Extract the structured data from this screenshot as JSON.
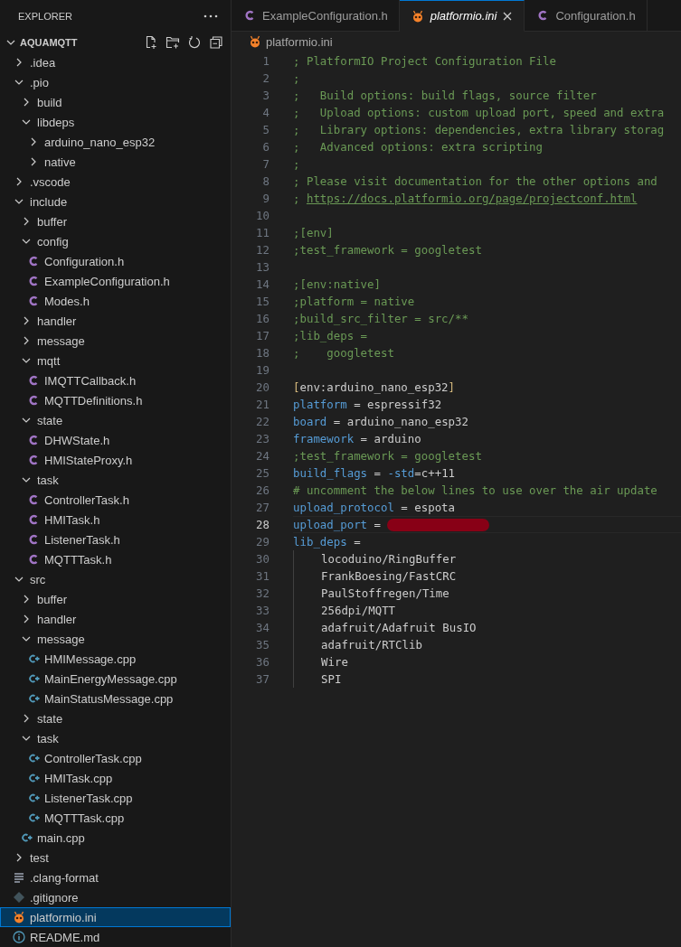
{
  "sidebar": {
    "title": "EXPLORER",
    "project": {
      "name": "AQUAMQTT",
      "expanded": true,
      "children": [
        {
          "name": ".idea",
          "kind": "folder",
          "expanded": false,
          "selected": false
        },
        {
          "name": ".pio",
          "kind": "folder",
          "expanded": true,
          "selected": false,
          "children": [
            {
              "name": "build",
              "kind": "folder",
              "expanded": false,
              "selected": false
            },
            {
              "name": "libdeps",
              "kind": "folder",
              "expanded": true,
              "selected": false,
              "children": [
                {
                  "name": "arduino_nano_esp32",
                  "kind": "folder",
                  "expanded": false,
                  "selected": false
                },
                {
                  "name": "native",
                  "kind": "folder",
                  "expanded": false,
                  "selected": false
                }
              ]
            }
          ]
        },
        {
          "name": ".vscode",
          "kind": "folder",
          "expanded": false,
          "selected": false
        },
        {
          "name": "include",
          "kind": "folder",
          "expanded": true,
          "selected": false,
          "children": [
            {
              "name": "buffer",
              "kind": "folder",
              "expanded": false,
              "selected": false
            },
            {
              "name": "config",
              "kind": "folder",
              "expanded": true,
              "selected": false,
              "children": [
                {
                  "name": "Configuration.h",
                  "kind": "c-header",
                  "selected": false
                },
                {
                  "name": "ExampleConfiguration.h",
                  "kind": "c-header",
                  "selected": false
                },
                {
                  "name": "Modes.h",
                  "kind": "c-header",
                  "selected": false
                }
              ]
            },
            {
              "name": "handler",
              "kind": "folder",
              "expanded": false,
              "selected": false
            },
            {
              "name": "message",
              "kind": "folder",
              "expanded": false,
              "selected": false
            },
            {
              "name": "mqtt",
              "kind": "folder",
              "expanded": true,
              "selected": false,
              "children": [
                {
                  "name": "IMQTTCallback.h",
                  "kind": "c-header",
                  "selected": false
                },
                {
                  "name": "MQTTDefinitions.h",
                  "kind": "c-header",
                  "selected": false
                }
              ]
            },
            {
              "name": "state",
              "kind": "folder",
              "expanded": true,
              "selected": false,
              "children": [
                {
                  "name": "DHWState.h",
                  "kind": "c-header",
                  "selected": false
                },
                {
                  "name": "HMIStateProxy.h",
                  "kind": "c-header",
                  "selected": false
                }
              ]
            },
            {
              "name": "task",
              "kind": "folder",
              "expanded": true,
              "selected": false,
              "children": [
                {
                  "name": "ControllerTask.h",
                  "kind": "c-header",
                  "selected": false
                },
                {
                  "name": "HMITask.h",
                  "kind": "c-header",
                  "selected": false
                },
                {
                  "name": "ListenerTask.h",
                  "kind": "c-header",
                  "selected": false
                },
                {
                  "name": "MQTTTask.h",
                  "kind": "c-header",
                  "selected": false
                }
              ]
            }
          ]
        },
        {
          "name": "src",
          "kind": "folder",
          "expanded": true,
          "selected": false,
          "children": [
            {
              "name": "buffer",
              "kind": "folder",
              "expanded": false,
              "selected": false
            },
            {
              "name": "handler",
              "kind": "folder",
              "expanded": false,
              "selected": false
            },
            {
              "name": "message",
              "kind": "folder",
              "expanded": true,
              "selected": false,
              "children": [
                {
                  "name": "HMIMessage.cpp",
                  "kind": "cpp",
                  "selected": false
                },
                {
                  "name": "MainEnergyMessage.cpp",
                  "kind": "cpp",
                  "selected": false
                },
                {
                  "name": "MainStatusMessage.cpp",
                  "kind": "cpp",
                  "selected": false
                }
              ]
            },
            {
              "name": "state",
              "kind": "folder",
              "expanded": false,
              "selected": false
            },
            {
              "name": "task",
              "kind": "folder",
              "expanded": true,
              "selected": false,
              "children": [
                {
                  "name": "ControllerTask.cpp",
                  "kind": "cpp",
                  "selected": false
                },
                {
                  "name": "HMITask.cpp",
                  "kind": "cpp",
                  "selected": false
                },
                {
                  "name": "ListenerTask.cpp",
                  "kind": "cpp",
                  "selected": false
                },
                {
                  "name": "MQTTTask.cpp",
                  "kind": "cpp",
                  "selected": false
                }
              ]
            },
            {
              "name": "main.cpp",
              "kind": "cpp",
              "selected": false
            }
          ]
        },
        {
          "name": "test",
          "kind": "folder",
          "expanded": false,
          "selected": false
        },
        {
          "name": ".clang-format",
          "kind": "lines",
          "selected": false
        },
        {
          "name": ".gitignore",
          "kind": "git",
          "selected": false
        },
        {
          "name": "platformio.ini",
          "kind": "pio",
          "selected": true
        },
        {
          "name": "README.md",
          "kind": "info",
          "selected": false
        }
      ]
    }
  },
  "tabs": [
    {
      "label": "ExampleConfiguration.h",
      "kind": "c-header",
      "selected": false,
      "preview": false
    },
    {
      "label": "platformio.ini",
      "kind": "pio",
      "selected": true,
      "preview": true
    },
    {
      "label": "Configuration.h",
      "kind": "c-header",
      "selected": false,
      "preview": false
    }
  ],
  "breadcrumb": {
    "label": "platformio.ini",
    "kind": "pio"
  },
  "editor": {
    "lines": [
      {
        "number": "1",
        "current": false,
        "tokens": [
          {
            "kind": "comment",
            "text": "; PlatformIO Project Configuration File"
          }
        ]
      },
      {
        "number": "2",
        "current": false,
        "tokens": [
          {
            "kind": "comment",
            "text": ";"
          }
        ]
      },
      {
        "number": "3",
        "current": false,
        "tokens": [
          {
            "kind": "comment",
            "text": ";   Build options: build flags, source filter"
          }
        ]
      },
      {
        "number": "4",
        "current": false,
        "tokens": [
          {
            "kind": "comment",
            "text": ";   Upload options: custom upload port, speed and extra"
          }
        ]
      },
      {
        "number": "5",
        "current": false,
        "tokens": [
          {
            "kind": "comment",
            "text": ";   Library options: dependencies, extra library storag"
          }
        ]
      },
      {
        "number": "6",
        "current": false,
        "tokens": [
          {
            "kind": "comment",
            "text": ";   Advanced options: extra scripting"
          }
        ]
      },
      {
        "number": "7",
        "current": false,
        "tokens": [
          {
            "kind": "comment",
            "text": ";"
          }
        ]
      },
      {
        "number": "8",
        "current": false,
        "tokens": [
          {
            "kind": "comment",
            "text": "; Please visit documentation for the other options and"
          }
        ]
      },
      {
        "number": "9",
        "current": false,
        "tokens": [
          {
            "kind": "comment",
            "text": "; "
          },
          {
            "kind": "link",
            "text": "https://docs.platformio.org/page/projectconf.html"
          }
        ]
      },
      {
        "number": "10",
        "current": false
      },
      {
        "number": "11",
        "current": false,
        "tokens": [
          {
            "kind": "comment",
            "text": ";[env]"
          }
        ]
      },
      {
        "number": "12",
        "current": false,
        "tokens": [
          {
            "kind": "comment",
            "text": ";test_framework = googletest"
          }
        ]
      },
      {
        "number": "13",
        "current": false
      },
      {
        "number": "14",
        "current": false,
        "tokens": [
          {
            "kind": "comment",
            "text": ";[env:native]"
          }
        ]
      },
      {
        "number": "15",
        "current": false,
        "tokens": [
          {
            "kind": "comment",
            "text": ";platform = native"
          }
        ]
      },
      {
        "number": "16",
        "current": false,
        "tokens": [
          {
            "kind": "comment",
            "text": ";build_src_filter = src/**"
          }
        ]
      },
      {
        "number": "17",
        "current": false,
        "tokens": [
          {
            "kind": "comment",
            "text": ";lib_deps ="
          }
        ]
      },
      {
        "number": "18",
        "current": false,
        "tokens": [
          {
            "kind": "comment",
            "text": ";    googletest"
          }
        ]
      },
      {
        "number": "19",
        "current": false
      },
      {
        "number": "20",
        "current": false,
        "tokens": [
          {
            "kind": "bracket",
            "text": "["
          },
          {
            "kind": "value",
            "text": "env:arduino_nano_esp32"
          },
          {
            "kind": "bracket",
            "text": "]"
          }
        ]
      },
      {
        "number": "21",
        "current": false,
        "tokens": [
          {
            "kind": "key",
            "text": "platform"
          },
          {
            "kind": "value",
            "text": " = espressif32"
          }
        ]
      },
      {
        "number": "22",
        "current": false,
        "tokens": [
          {
            "kind": "key",
            "text": "board"
          },
          {
            "kind": "value",
            "text": " = arduino_nano_esp32"
          }
        ]
      },
      {
        "number": "23",
        "current": false,
        "tokens": [
          {
            "kind": "key",
            "text": "framework"
          },
          {
            "kind": "value",
            "text": " = arduino"
          }
        ]
      },
      {
        "number": "24",
        "current": false,
        "tokens": [
          {
            "kind": "comment",
            "text": ";test_framework = googletest"
          }
        ]
      },
      {
        "number": "25",
        "current": false,
        "tokens": [
          {
            "kind": "key",
            "text": "build_flags"
          },
          {
            "kind": "value",
            "text": " = "
          },
          {
            "kind": "key",
            "text": "-std"
          },
          {
            "kind": "value",
            "text": "=c++11"
          }
        ]
      },
      {
        "number": "26",
        "current": false,
        "tokens": [
          {
            "kind": "comment",
            "text": "# uncomment the below lines to use over the air update"
          }
        ]
      },
      {
        "number": "27",
        "current": false,
        "tokens": [
          {
            "kind": "key",
            "text": "upload_protocol"
          },
          {
            "kind": "value",
            "text": " = espota"
          }
        ]
      },
      {
        "number": "28",
        "current": true,
        "tokens": [
          {
            "kind": "key",
            "text": "upload_port"
          },
          {
            "kind": "value",
            "text": " = "
          },
          {
            "kind": "redacted"
          }
        ]
      },
      {
        "number": "29",
        "current": false,
        "tokens": [
          {
            "kind": "key",
            "text": "lib_deps"
          },
          {
            "kind": "value",
            "text": " ="
          }
        ]
      },
      {
        "number": "30",
        "current": false,
        "tokens": [
          {
            "kind": "indent"
          },
          {
            "kind": "value",
            "text": "locoduino/RingBuffer"
          }
        ]
      },
      {
        "number": "31",
        "current": false,
        "tokens": [
          {
            "kind": "indent"
          },
          {
            "kind": "value",
            "text": "FrankBoesing/FastCRC"
          }
        ]
      },
      {
        "number": "32",
        "current": false,
        "tokens": [
          {
            "kind": "indent"
          },
          {
            "kind": "value",
            "text": "PaulStoffregen/Time"
          }
        ]
      },
      {
        "number": "33",
        "current": false,
        "tokens": [
          {
            "kind": "indent"
          },
          {
            "kind": "value",
            "text": "256dpi/MQTT"
          }
        ]
      },
      {
        "number": "34",
        "current": false,
        "tokens": [
          {
            "kind": "indent"
          },
          {
            "kind": "value",
            "text": "adafruit/Adafruit BusIO"
          }
        ]
      },
      {
        "number": "35",
        "current": false,
        "tokens": [
          {
            "kind": "indent"
          },
          {
            "kind": "value",
            "text": "adafruit/RTClib"
          }
        ]
      },
      {
        "number": "36",
        "current": false,
        "tokens": [
          {
            "kind": "indent"
          },
          {
            "kind": "value",
            "text": "Wire"
          }
        ]
      },
      {
        "number": "37",
        "current": false,
        "tokens": [
          {
            "kind": "indent"
          },
          {
            "kind": "value",
            "text": "SPI"
          }
        ]
      }
    ]
  }
}
